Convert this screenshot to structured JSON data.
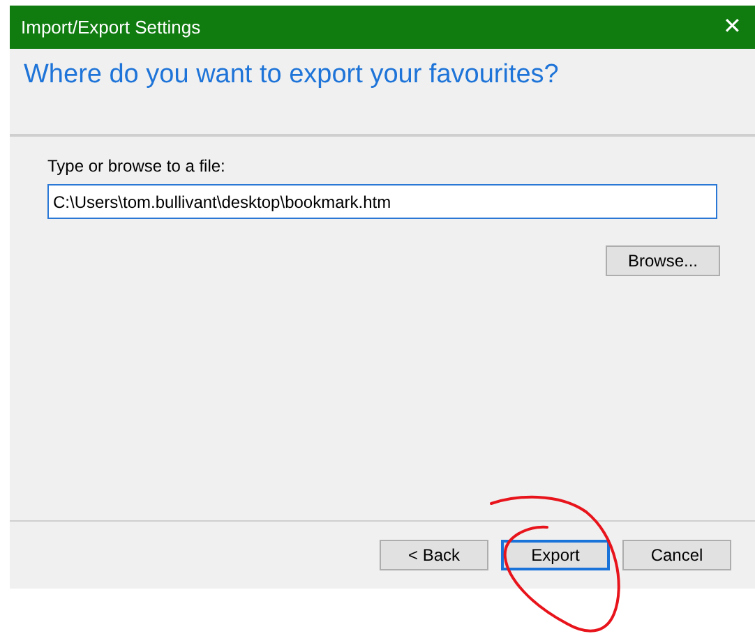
{
  "window": {
    "title": "Import/Export Settings",
    "close": "✕"
  },
  "heading": "Where do you want to export your favourites?",
  "file_field": {
    "label": "Type or browse to a file:",
    "value": "C:\\Users\\tom.bullivant\\desktop\\bookmark.htm",
    "focused": false
  },
  "browse_button": "Browse...",
  "buttons": [
    {
      "label": "< Back",
      "default": false
    },
    {
      "label": "Export",
      "default": true
    },
    {
      "label": "Cancel",
      "default": false
    }
  ],
  "annotation": {
    "kind": "circle",
    "color": "#e8141c"
  }
}
